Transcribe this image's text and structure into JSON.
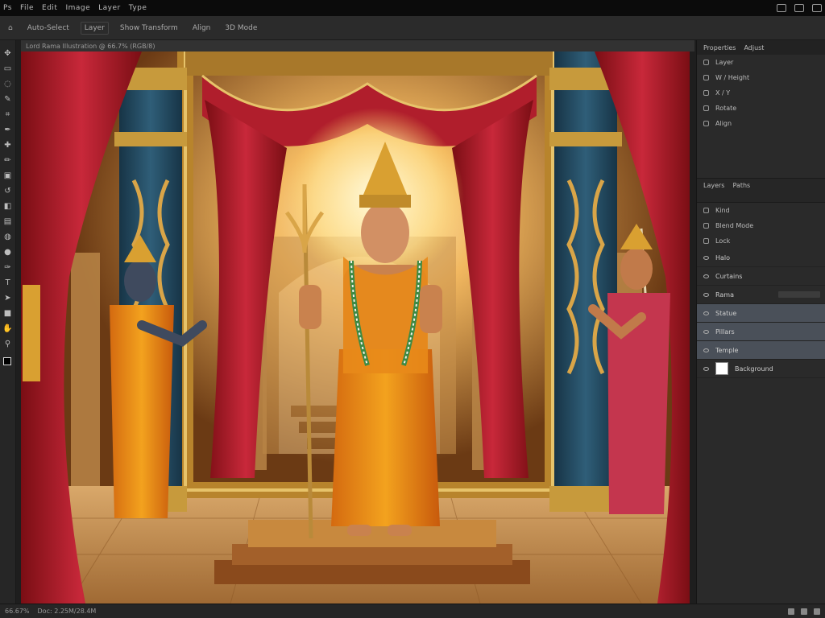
{
  "menubar": {
    "items": [
      "Ps",
      "File",
      "Edit",
      "Image",
      "Layer",
      "Type"
    ]
  },
  "options_bar": {
    "items": [
      "Auto-Select",
      "Layer",
      "Show Transform",
      "Align",
      "3D Mode"
    ]
  },
  "document": {
    "tab_title": "Lord Rama Illustration @ 66.7% (RGB/8)"
  },
  "tools": [
    "move",
    "marquee",
    "lasso",
    "quick-select",
    "crop",
    "eyedropper",
    "spot-heal",
    "brush",
    "stamp",
    "history",
    "eraser",
    "gradient",
    "blur",
    "dodge",
    "pen",
    "type",
    "path-select",
    "shape",
    "hand",
    "zoom"
  ],
  "colors": {
    "accent": "#4a5059",
    "panel_bg": "#2a2a2a",
    "menubar_bg": "#0b0b0b",
    "selected_layer": "#4a5059"
  },
  "properties_panel": {
    "tabs": [
      "Properties",
      "Adjust"
    ],
    "rows": [
      "Layer",
      "W / Height",
      "X / Y",
      "Rotate",
      "Align"
    ]
  },
  "layers_panel": {
    "tabs": [
      "Layers",
      "Paths"
    ],
    "filter_rows": [
      "Kind",
      "Blend Mode"
    ],
    "lock_label": "Lock",
    "layers": [
      {
        "name": "Halo",
        "selected": false
      },
      {
        "name": "Curtains",
        "selected": false
      },
      {
        "name": "Rama",
        "selected": false
      },
      {
        "name": "Statue",
        "selected": true
      },
      {
        "name": "Pillars",
        "selected": true
      },
      {
        "name": "Temple",
        "selected": true
      },
      {
        "name": "Background",
        "selected": false
      }
    ]
  },
  "statusbar": {
    "zoom": "66.67%",
    "doc_info": "Doc: 2.25M/28.4M"
  }
}
